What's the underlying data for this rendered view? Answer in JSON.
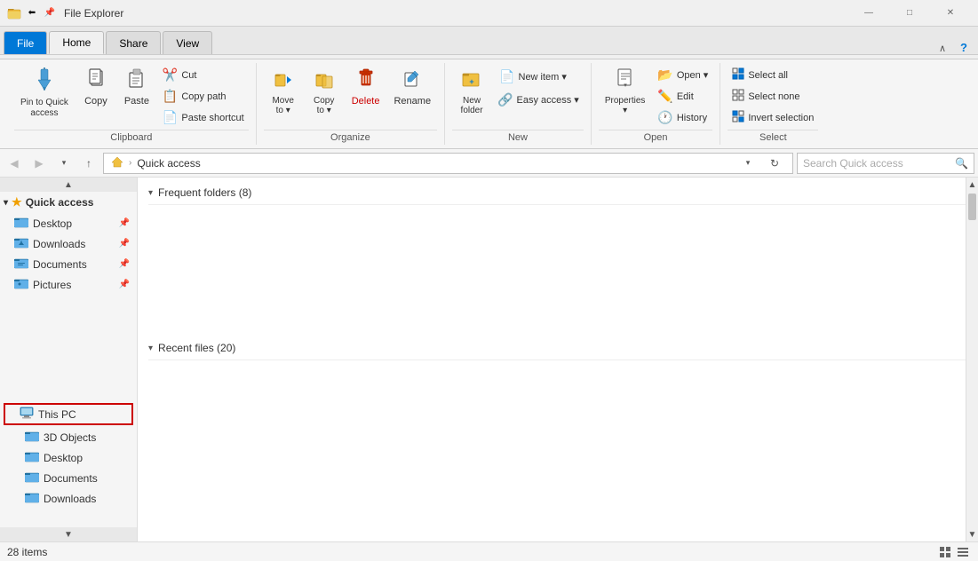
{
  "titlebar": {
    "title": "File Explorer",
    "icons": [
      "🗂️"
    ],
    "controls": {
      "minimize": "—",
      "maximize": "□",
      "close": "✕"
    }
  },
  "tabs": [
    {
      "label": "File",
      "active": false,
      "type": "file"
    },
    {
      "label": "Home",
      "active": true
    },
    {
      "label": "Share",
      "active": false
    },
    {
      "label": "View",
      "active": false
    }
  ],
  "ribbon": {
    "groups": [
      {
        "name": "Clipboard",
        "items_large": [
          {
            "id": "pin-to-quick",
            "icon": "📌",
            "label": "Pin to Quick\naccess"
          },
          {
            "id": "copy",
            "icon": "📋",
            "label": "Copy"
          },
          {
            "id": "paste",
            "icon": "📄",
            "label": "Paste"
          }
        ],
        "items_small": [
          {
            "id": "cut",
            "icon": "✂️",
            "label": "Cut"
          },
          {
            "id": "copy-path",
            "icon": "📋",
            "label": "Copy path"
          },
          {
            "id": "paste-shortcut",
            "icon": "📄",
            "label": "Paste shortcut"
          }
        ]
      },
      {
        "name": "Organize",
        "items_large": [
          {
            "id": "move-to",
            "icon": "📁",
            "label": "Move\nto ▾"
          },
          {
            "id": "copy-to",
            "icon": "📁",
            "label": "Copy\nto ▾"
          },
          {
            "id": "delete",
            "icon": "🗑",
            "label": "Delete",
            "color": "red"
          },
          {
            "id": "rename",
            "icon": "✏️",
            "label": "Rename"
          }
        ]
      },
      {
        "name": "New",
        "items_large": [
          {
            "id": "new-folder",
            "icon": "📁",
            "label": "New\nfolder"
          },
          {
            "id": "new-item",
            "icon": "📄",
            "label": "New item ▾"
          }
        ],
        "items_small": [
          {
            "id": "easy-access",
            "icon": "🔗",
            "label": "Easy access ▾"
          }
        ]
      },
      {
        "name": "Open",
        "items_large": [
          {
            "id": "properties",
            "icon": "🔧",
            "label": "Properties\n▾"
          }
        ],
        "items_small": [
          {
            "id": "open",
            "icon": "📂",
            "label": "Open ▾"
          },
          {
            "id": "edit",
            "icon": "✏️",
            "label": "Edit"
          },
          {
            "id": "history",
            "icon": "🕐",
            "label": "History"
          }
        ]
      },
      {
        "name": "Select",
        "items_small": [
          {
            "id": "select-all",
            "icon": "☑",
            "label": "Select all"
          },
          {
            "id": "select-none",
            "icon": "☐",
            "label": "Select none"
          },
          {
            "id": "invert-selection",
            "icon": "⊡",
            "label": "Invert selection"
          }
        ]
      }
    ]
  },
  "navbar": {
    "back_disabled": true,
    "forward_disabled": true,
    "up_label": "↑",
    "path_parts": [
      "Quick access"
    ],
    "search_placeholder": "Search Quick access"
  },
  "sidebar": {
    "quick_access_label": "Quick access",
    "quick_access_items": [
      {
        "label": "Desktop",
        "pinned": true
      },
      {
        "label": "Downloads",
        "pinned": true
      },
      {
        "label": "Documents",
        "pinned": true
      },
      {
        "label": "Pictures",
        "pinned": true
      }
    ],
    "this_pc_label": "This PC",
    "this_pc_items": [
      {
        "label": "3D Objects"
      },
      {
        "label": "Desktop"
      },
      {
        "label": "Documents"
      },
      {
        "label": "Downloads"
      }
    ]
  },
  "content": {
    "frequent_folders_label": "Frequent folders (8)",
    "recent_files_label": "Recent files (20)"
  },
  "statusbar": {
    "item_count": "28 items",
    "view_tiles": "⊞",
    "view_list": "≡"
  }
}
